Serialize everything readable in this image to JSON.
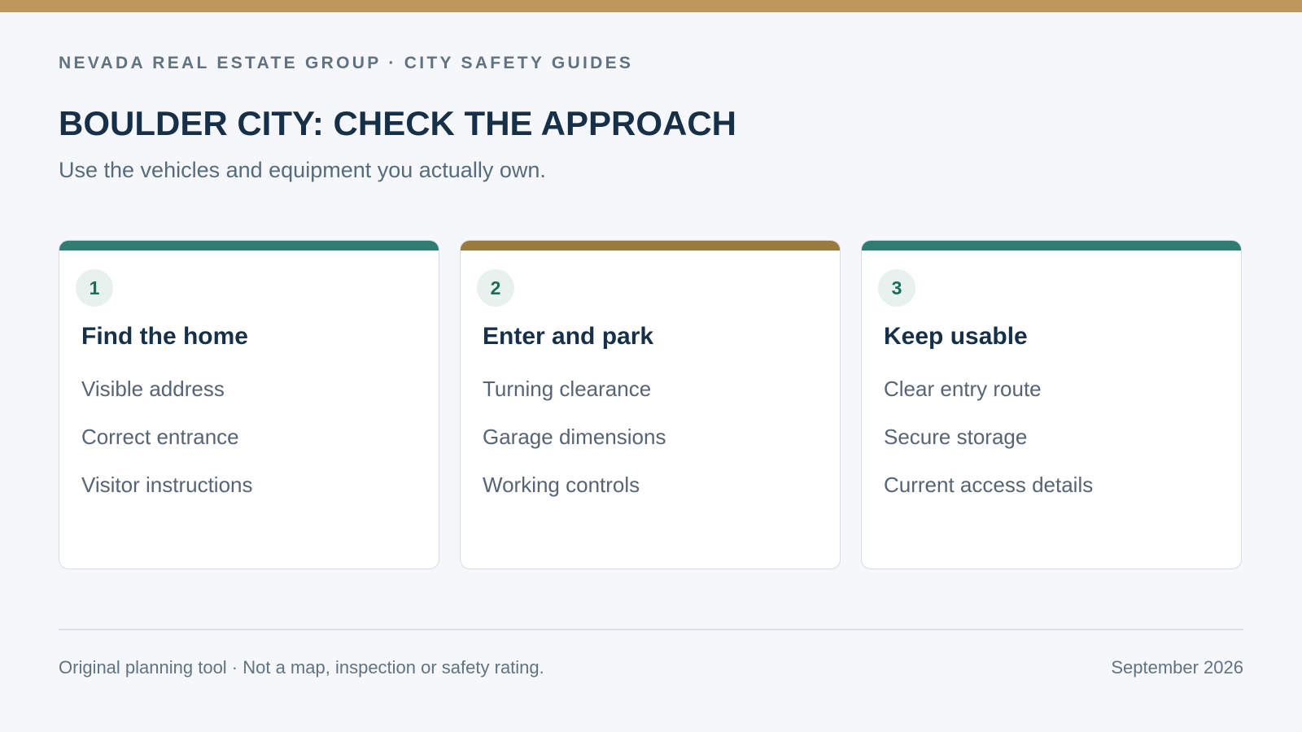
{
  "header": {
    "eyebrow": "NEVADA REAL ESTATE GROUP · CITY SAFETY GUIDES",
    "title": "BOULDER CITY: CHECK THE APPROACH",
    "subtitle": "Use the vehicles and equipment you actually own."
  },
  "colors": {
    "top_bar": "#bd975a",
    "teal_accent": "#2f7d72",
    "gold_accent": "#9b7a3d",
    "title_text": "#17304a"
  },
  "cards": [
    {
      "number": "1",
      "title": "Find the home",
      "accent": "#2f7d72",
      "items": [
        "Visible address",
        "Correct entrance",
        "Visitor instructions"
      ]
    },
    {
      "number": "2",
      "title": "Enter and park",
      "accent": "#9b7a3d",
      "items": [
        "Turning clearance",
        "Garage dimensions",
        "Working controls"
      ]
    },
    {
      "number": "3",
      "title": "Keep usable",
      "accent": "#2f7d72",
      "items": [
        "Clear entry route",
        "Secure storage",
        "Current access details"
      ]
    }
  ],
  "footer": {
    "note": "Original planning tool · Not a map, inspection or safety rating.",
    "date": "September 2026"
  }
}
